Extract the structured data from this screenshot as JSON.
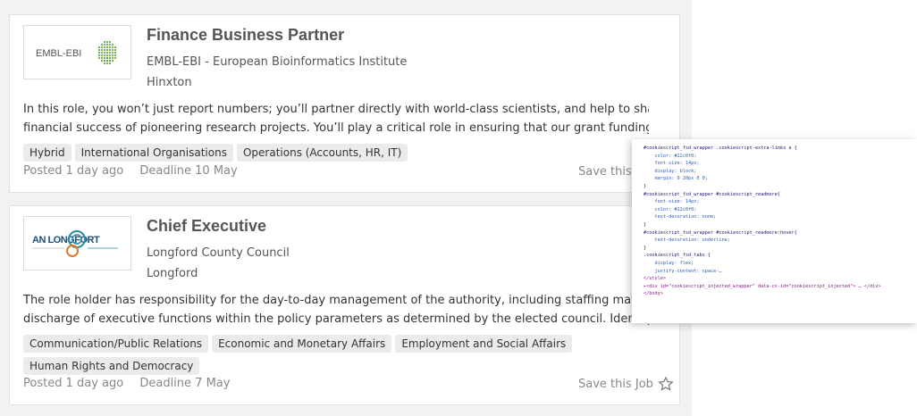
{
  "jobs": [
    {
      "title": "Finance Business Partner",
      "employer": "EMBL-EBI - European Bioinformatics Institute",
      "location": "Hinxton",
      "logo_text": "EMBL-EBI",
      "description_lines": [
        "In this role, you won’t just report numbers; you’ll partner directly with world-class scientists, and help to shape the",
        "financial success of pioneering research projects. You’ll play a critical role in ensuring that our grant funding is..."
      ],
      "tags": [
        "Hybrid",
        "International Organisations",
        "Operations (Accounts, HR, IT)"
      ],
      "posted": "Posted 1 day ago",
      "deadline": "Deadline 10 May",
      "save_label": "Save this Job"
    },
    {
      "title": "Chief Executive",
      "employer": "Longford County Council",
      "location": "Longford",
      "logo_text": "AN LONGFORT",
      "description_lines": [
        "The role holder has responsibility for the day-to-day management of the authority, including staffing matters and",
        "discharge of executive functions within the policy parameters as determined by the elected council. Identify and c"
      ],
      "tags": [
        "Communication/Public Relations",
        "Economic and Monetary Affairs",
        "Employment and Social Affairs",
        "Human Rights and Democracy"
      ],
      "posted": "Posted 1 day ago",
      "deadline": "Deadline 7 May",
      "save_label": "Save this Job"
    }
  ],
  "code_popup": {
    "lines": [
      "#cookiescript_fsd_wrapper .cookiescript-extra-links a {",
      "    color: #22c0f0;",
      "    font-size: 14px;",
      "    display: block;",
      "    margin: 0 20px 0 0;",
      "}",
      "",
      "",
      "#cookiescript_fsd_wrapper #cookiescript_readmore{",
      "    font-size: 14px;",
      "    color: #22c0f0;",
      "    text-decoration: none;",
      "}",
      "#cookiescript_fsd_wrapper #cookiescript_readmore:hover{",
      "    text-decoration: underline;",
      "}",
      "",
      ".cookiescript_fsd_tabs {",
      "    display: flex;",
      "    justify-content: space-…",
      "</style>",
      "▸<div id=\"cookiescript_injected_wrapper\" data-cs-id=\"cookiescript_injected\"> … </div>",
      "</body>"
    ]
  },
  "icons": {
    "save": "star-icon"
  },
  "colors": {
    "title": "#555555",
    "embl_green": "#6aa84f",
    "longford_teal": "#2e8b9a",
    "longford_orange": "#e07a2a"
  }
}
